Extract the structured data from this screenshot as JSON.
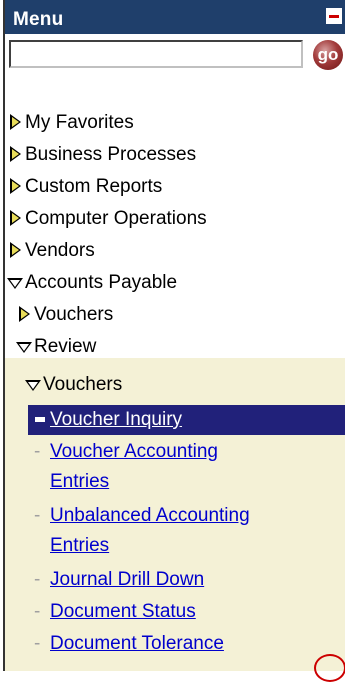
{
  "menu": {
    "title": "Menu",
    "search": {
      "value": "",
      "go_label": "go"
    },
    "items": [
      {
        "label": "My Favorites"
      },
      {
        "label": "Business Processes"
      },
      {
        "label": "Custom Reports"
      },
      {
        "label": "Computer Operations"
      },
      {
        "label": "Vendors"
      },
      {
        "label": "Accounts Payable"
      },
      {
        "label": "Vouchers"
      },
      {
        "label": "Review"
      },
      {
        "label": "Vouchers"
      }
    ],
    "leaves": [
      {
        "label": "Voucher Inquiry"
      },
      {
        "label_line1": "Voucher Accounting",
        "label_line2": "Entries"
      },
      {
        "label_line1": "Unbalanced Accounting",
        "label_line2": "Entries"
      },
      {
        "label": "Journal Drill Down"
      },
      {
        "label": "Document Status"
      },
      {
        "label": "Document Tolerance"
      }
    ]
  },
  "colors": {
    "header_bg": "#1f3f6b",
    "selected_bg": "#21217a",
    "link": "#0000cc",
    "section_bg": "#f4f1d6",
    "folder_triangle": "#e8dc5a",
    "annotation_circle": "#cc0000"
  }
}
